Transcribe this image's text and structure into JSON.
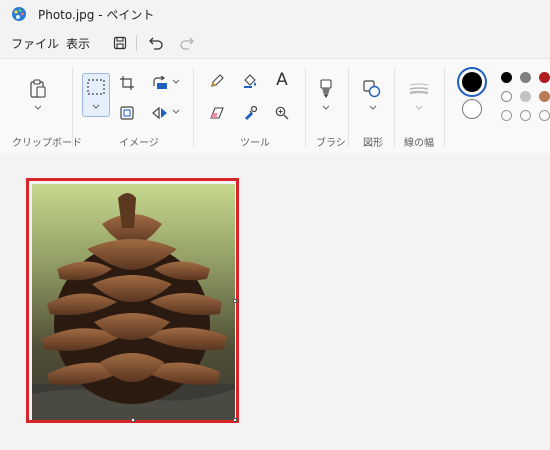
{
  "window": {
    "title": "Photo.jpg - ペイント",
    "app_icon": "paint-palette-icon"
  },
  "menu": {
    "file": "ファイル",
    "view": "表示"
  },
  "toolbar_icons": [
    "save-icon",
    "undo-icon",
    "redo-icon"
  ],
  "ribbon": {
    "groups": {
      "clipboard": "クリップボード",
      "image": "イメージ",
      "tools": "ツール",
      "brushes": "ブラシ",
      "shapes": "図形",
      "line_width": "線の幅"
    },
    "text_tool_glyph": "A"
  },
  "colors": {
    "primary": "#000000",
    "secondary": "#ffffff",
    "palette": [
      "#000000",
      "#7f7f7f",
      "#b01c1c",
      "#ffffff",
      "#c3c3c3",
      "#b97a57"
    ],
    "accent_selection": "#d7262b"
  },
  "document": {
    "subject": "pine cone photo"
  }
}
